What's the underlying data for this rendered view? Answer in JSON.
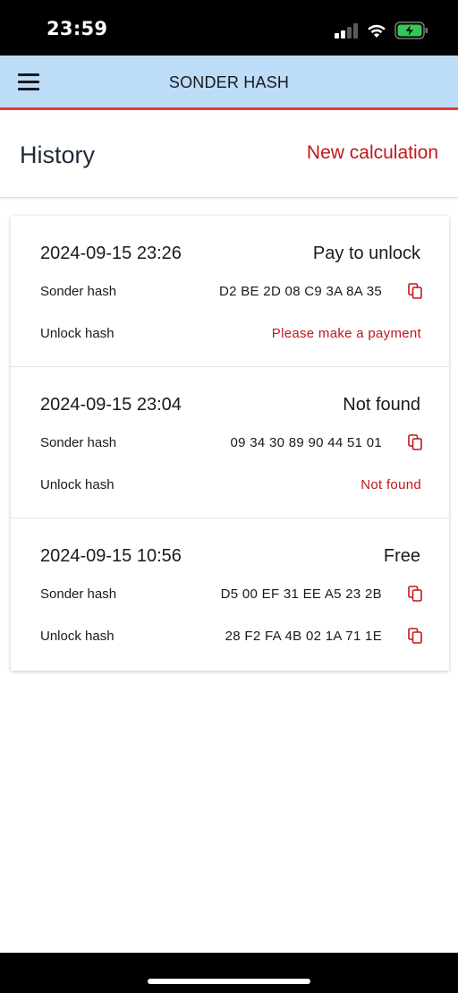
{
  "status_bar": {
    "time": "23:59"
  },
  "app_bar": {
    "title": "SONDER HASH",
    "menu_icon": "hamburger-menu-icon"
  },
  "page": {
    "title": "History",
    "new_calculation": "New calculation"
  },
  "history": [
    {
      "date": "2024-09-15 23:26",
      "status": "Pay to unlock",
      "sonder_label": "Sonder hash",
      "sonder_hash": "D2 BE 2D 08 C9 3A 8A 35",
      "unlock_label": "Unlock hash",
      "unlock_hash": "Please make a payment",
      "unlock_copy": false
    },
    {
      "date": "2024-09-15 23:04",
      "status": "Not found",
      "sonder_label": "Sonder hash",
      "sonder_hash": "09 34 30 89 90 44 51 01",
      "unlock_label": "Unlock hash",
      "unlock_hash": "Not found",
      "unlock_copy": false
    },
    {
      "date": "2024-09-15 10:56",
      "status": "Free",
      "sonder_label": "Sonder hash",
      "sonder_hash": "D5 00 EF 31 EE A5 23 2B",
      "unlock_label": "Unlock hash",
      "unlock_hash": "28 F2 FA 4B 02 1A 71 1E",
      "unlock_copy": true
    }
  ],
  "colors": {
    "accent": "#c0161c",
    "app_bar": "#bcdcf8",
    "app_bar_border": "#e53935"
  }
}
